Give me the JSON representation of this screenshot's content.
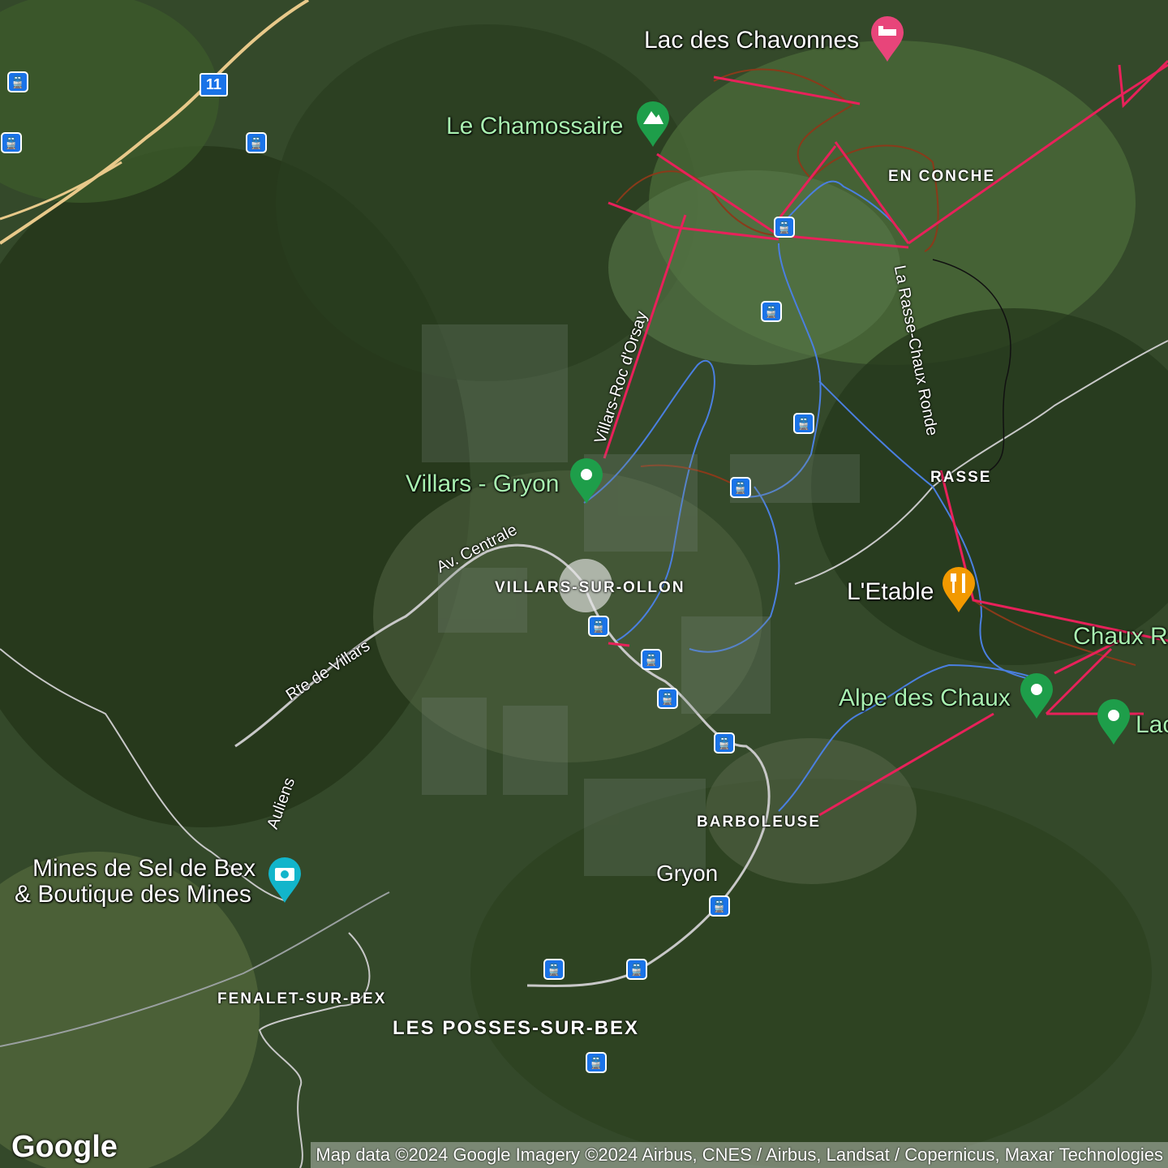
{
  "map": {
    "poi_labels": {
      "lac_chavonnes": "Lac des Chavonnes",
      "chamossaire": "Le Chamossaire",
      "villars_gryon": "Villars - Gryon",
      "l_etable": "L'Etable",
      "chaux_ronde": "Chaux R",
      "alpe_des_chaux": "Alpe des Chaux",
      "lac_partial": "Lac",
      "mines_line1": "Mines de Sel de Bex",
      "mines_line2": "& Boutique des Mines"
    },
    "place_labels": {
      "en_conche": "EN CONCHE",
      "rasse": "RASSE",
      "villars_sur_ollon": "VILLARS-SUR-OLLON",
      "barboleuse": "BARBOLEUSE",
      "gryon": "Gryon",
      "fenalet": "FENALET-SUR-BEX",
      "les_posses": "LES POSSES-SUR-BEX"
    },
    "road_labels": {
      "roc_dorsay": "Villars-Roc d'Orsay",
      "rasse_chaux": "La Rasse-Chaux Ronde",
      "av_centrale": "Av. Centrale",
      "rte_de_villars": "Rte de Villars",
      "auliens": "Auliens"
    },
    "route_shield": "11",
    "icons": {
      "transit": "train-icon",
      "lodging": "bed-icon",
      "peak": "mountain-icon",
      "food": "restaurant-icon",
      "attraction": "camera-icon"
    },
    "colors": {
      "ski_lift": "#e8215a",
      "piste": "#8a3a1a",
      "trail": "#4a7fe0",
      "transit": "#1a73e8",
      "poi_green": "#1e9e4a",
      "food": "#f29900",
      "lodging": "#e8457a"
    }
  },
  "branding": {
    "logo": "Google",
    "attribution": "Map data ©2024 Google Imagery ©2024 Airbus, CNES / Airbus, Landsat / Copernicus, Maxar Technologies"
  }
}
